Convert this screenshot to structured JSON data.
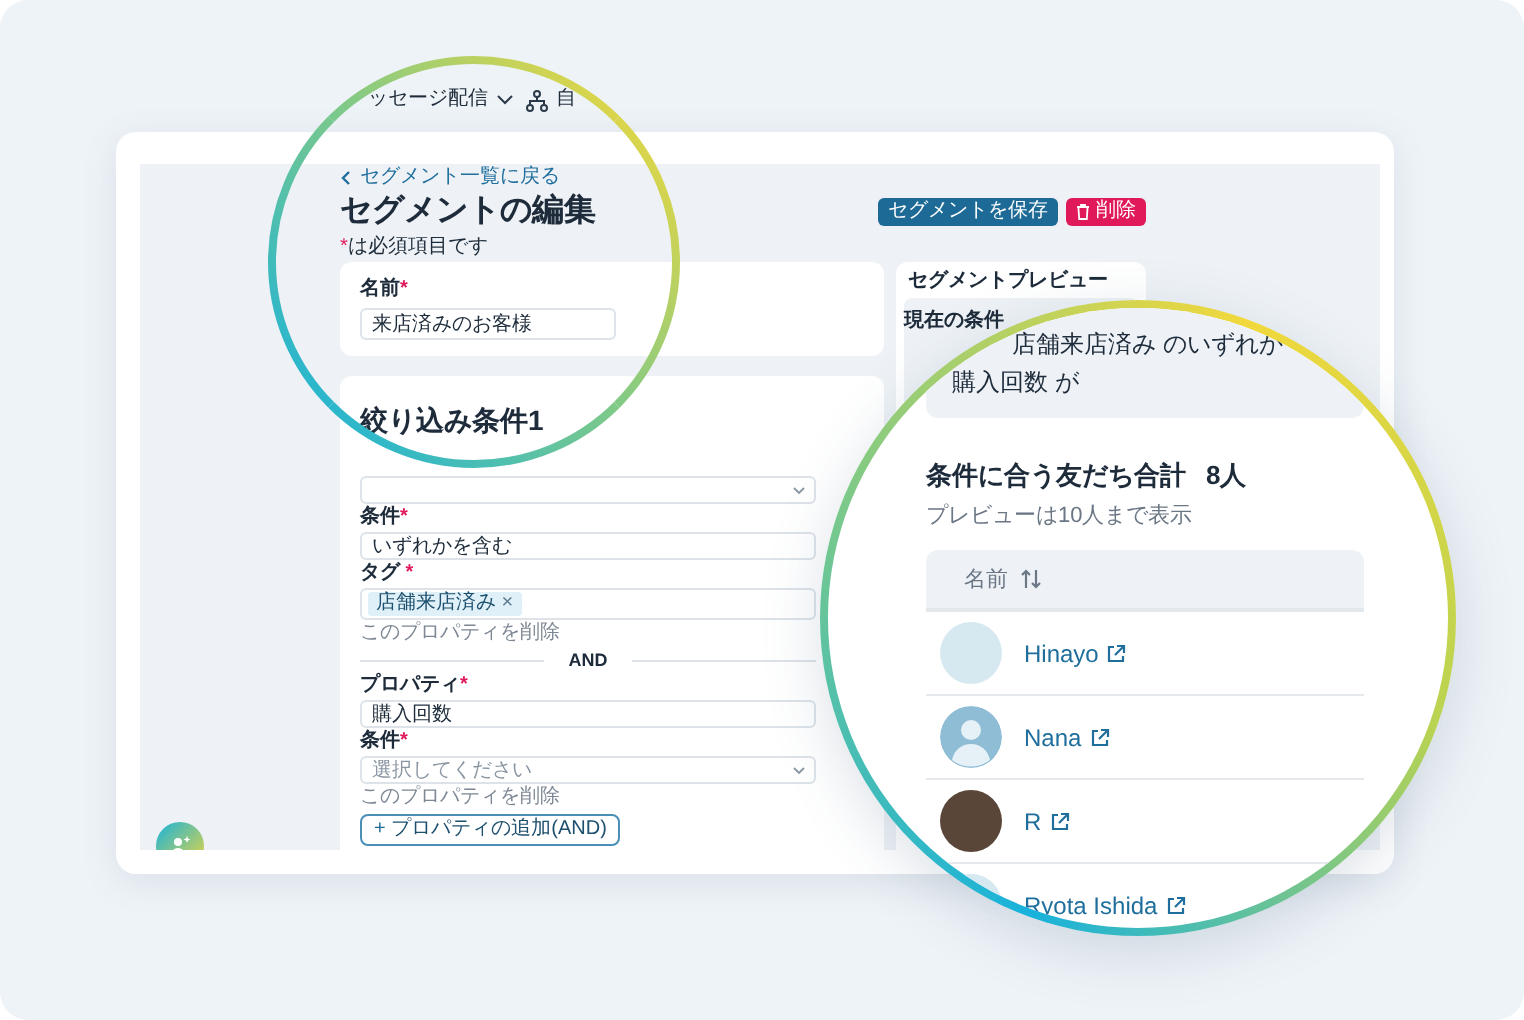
{
  "nav": [
    {
      "label": "ッセージ配信",
      "kind": "dropdown"
    },
    {
      "label": "自",
      "kind": "tree"
    }
  ],
  "back_link": "セグメント一覧に戻る",
  "title": "セグメントの編集",
  "required_note": {
    "mark": "*",
    "text": "は必須項目です"
  },
  "actions": [
    {
      "label": "セグメントを保存",
      "kind": "primary"
    },
    {
      "label": "削除",
      "kind": "danger"
    }
  ],
  "name_card": {
    "label": "名前",
    "required_mark": "*",
    "value": "来店済みのお客様"
  },
  "condition": {
    "title": "絞り込み条件1",
    "rows": [
      {
        "kind": "select"
      },
      {
        "kind": "field",
        "label": "条件",
        "required_mark": "*",
        "value": "いずれかを含む"
      },
      {
        "kind": "tags",
        "label": "タグ",
        "required_mark": "*",
        "tags": [
          {
            "label": "店舗来店済み",
            "remove": "×"
          }
        ]
      },
      {
        "kind": "remove_link",
        "label": "このプロパティを削除"
      },
      {
        "kind": "divider",
        "label": "AND"
      },
      {
        "kind": "field",
        "label": "プロパティ",
        "required_mark": "*",
        "value": "購入回数"
      },
      {
        "kind": "select",
        "label": "条件",
        "required_mark": "*",
        "placeholder": "選択してください"
      },
      {
        "kind": "remove_link",
        "label": "このプロパティを削除"
      },
      {
        "kind": "add_button",
        "label": "プロパティの追加(AND)",
        "icon": "+"
      }
    ]
  },
  "preview": {
    "title": "セグメントプレビュー",
    "condition_label": "現在の条件",
    "condition_lines": [
      "店舗来店済み のいずれか",
      "購入回数 が"
    ],
    "total_label": "条件に合う友だち合計",
    "total_count": "8人",
    "note": "プレビューは10人まで表示",
    "column": "名前",
    "friends": [
      {
        "name": "Hinayo",
        "kind": "photo"
      },
      {
        "name": "Nana",
        "kind": "default"
      },
      {
        "name": "R",
        "kind": "photo"
      },
      {
        "name": "Ryota Ishida",
        "kind": "photo"
      }
    ]
  }
}
